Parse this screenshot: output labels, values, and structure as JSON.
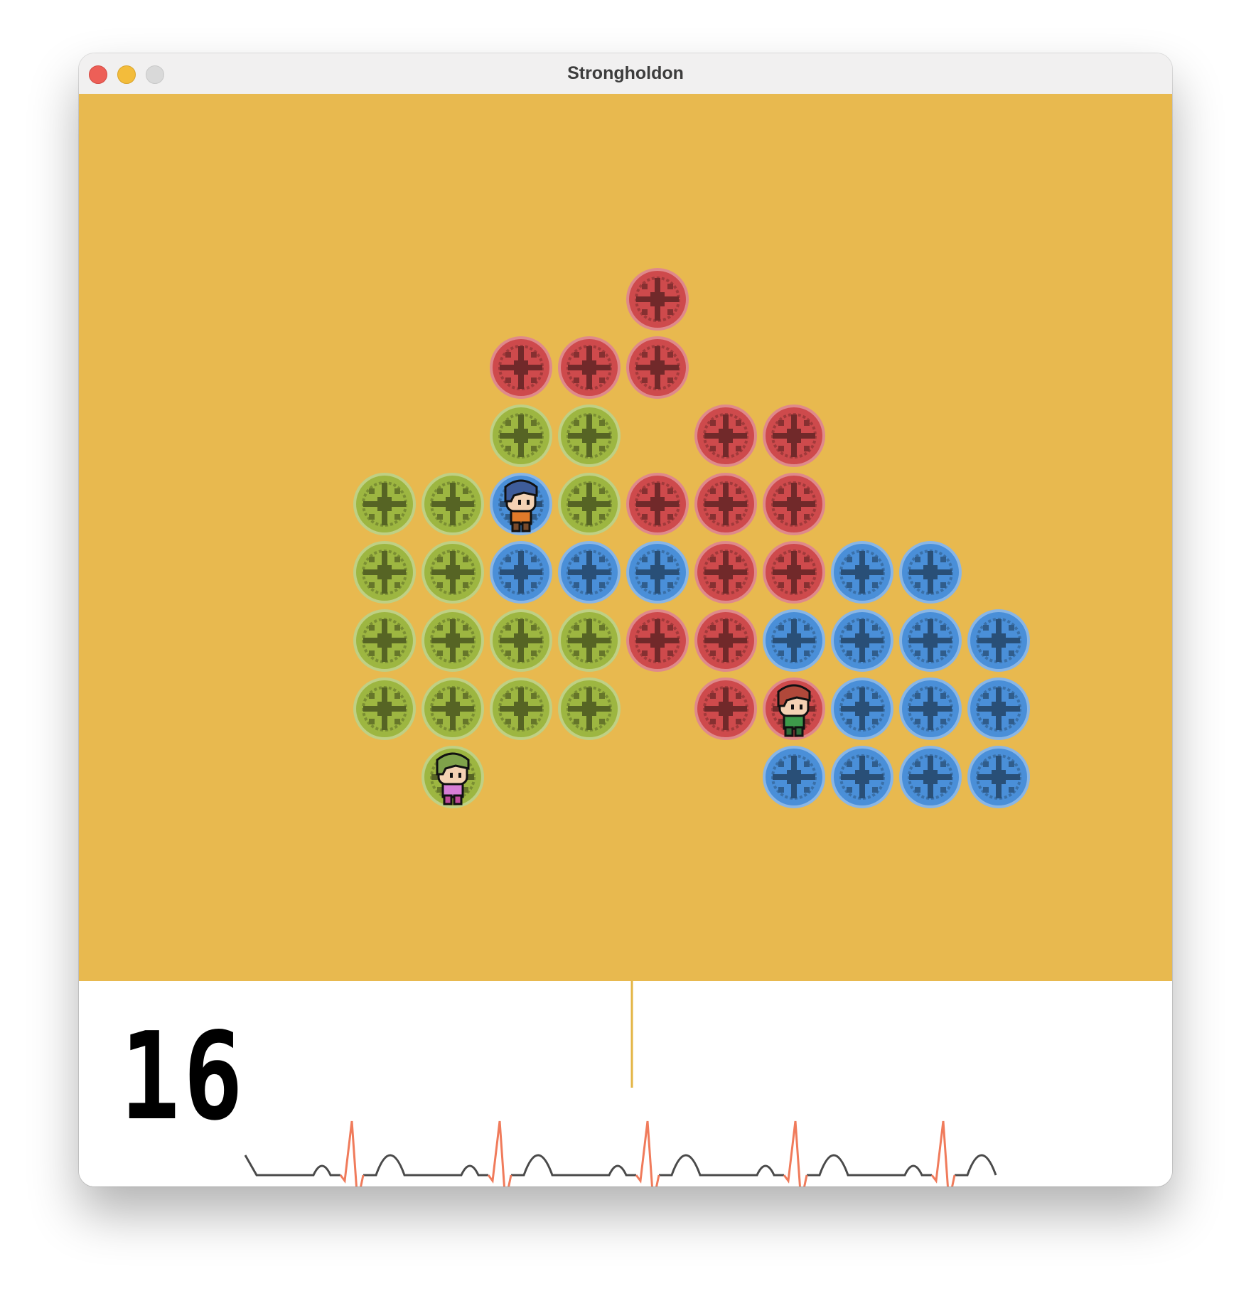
{
  "window": {
    "title": "Strongholdon"
  },
  "colors": {
    "board_background": "#E8B94F",
    "red_tile": "#CE4A4C",
    "green_tile": "#9DB641",
    "blue_tile": "#4A8FD8",
    "ecg_baseline": "#4a4a4a",
    "ecg_spike": "#F07B5B",
    "ecg_cursor": "#E3B545"
  },
  "board": {
    "columns": 12,
    "rows": 8,
    "tiles": [
      {
        "col": 4,
        "row": 0,
        "color": "red"
      },
      {
        "col": 2,
        "row": 1,
        "color": "red"
      },
      {
        "col": 3,
        "row": 1,
        "color": "red"
      },
      {
        "col": 4,
        "row": 1,
        "color": "red"
      },
      {
        "col": 2,
        "row": 2,
        "color": "green"
      },
      {
        "col": 3,
        "row": 2,
        "color": "green"
      },
      {
        "col": 5,
        "row": 2,
        "color": "red"
      },
      {
        "col": 6,
        "row": 2,
        "color": "red"
      },
      {
        "col": 0,
        "row": 3,
        "color": "green"
      },
      {
        "col": 1,
        "row": 3,
        "color": "green"
      },
      {
        "col": 2,
        "row": 3,
        "color": "blue"
      },
      {
        "col": 3,
        "row": 3,
        "color": "green"
      },
      {
        "col": 4,
        "row": 3,
        "color": "red"
      },
      {
        "col": 5,
        "row": 3,
        "color": "red"
      },
      {
        "col": 6,
        "row": 3,
        "color": "red"
      },
      {
        "col": 0,
        "row": 4,
        "color": "green"
      },
      {
        "col": 1,
        "row": 4,
        "color": "green"
      },
      {
        "col": 2,
        "row": 4,
        "color": "blue"
      },
      {
        "col": 3,
        "row": 4,
        "color": "blue"
      },
      {
        "col": 4,
        "row": 4,
        "color": "blue"
      },
      {
        "col": 5,
        "row": 4,
        "color": "red"
      },
      {
        "col": 6,
        "row": 4,
        "color": "red"
      },
      {
        "col": 7,
        "row": 4,
        "color": "blue"
      },
      {
        "col": 8,
        "row": 4,
        "color": "blue"
      },
      {
        "col": 0,
        "row": 5,
        "color": "green"
      },
      {
        "col": 1,
        "row": 5,
        "color": "green"
      },
      {
        "col": 2,
        "row": 5,
        "color": "green"
      },
      {
        "col": 3,
        "row": 5,
        "color": "green"
      },
      {
        "col": 4,
        "row": 5,
        "color": "red"
      },
      {
        "col": 5,
        "row": 5,
        "color": "red"
      },
      {
        "col": 6,
        "row": 5,
        "color": "blue"
      },
      {
        "col": 7,
        "row": 5,
        "color": "blue"
      },
      {
        "col": 8,
        "row": 5,
        "color": "blue"
      },
      {
        "col": 9,
        "row": 5,
        "color": "blue"
      },
      {
        "col": 0,
        "row": 6,
        "color": "green"
      },
      {
        "col": 1,
        "row": 6,
        "color": "green"
      },
      {
        "col": 2,
        "row": 6,
        "color": "green"
      },
      {
        "col": 3,
        "row": 6,
        "color": "green"
      },
      {
        "col": 5,
        "row": 6,
        "color": "red"
      },
      {
        "col": 6,
        "row": 6,
        "color": "red"
      },
      {
        "col": 7,
        "row": 6,
        "color": "blue"
      },
      {
        "col": 8,
        "row": 6,
        "color": "blue"
      },
      {
        "col": 9,
        "row": 6,
        "color": "blue"
      },
      {
        "col": 1,
        "row": 7,
        "color": "green"
      },
      {
        "col": 6,
        "row": 7,
        "color": "blue"
      },
      {
        "col": 7,
        "row": 7,
        "color": "blue"
      },
      {
        "col": 8,
        "row": 7,
        "color": "blue"
      },
      {
        "col": 9,
        "row": 7,
        "color": "blue"
      }
    ],
    "characters": [
      {
        "name": "blue-haired-hero",
        "col": 2,
        "row": 3,
        "hair": "#3E5C9A",
        "shirt": "#E07A2A",
        "pants": "#7A4A2A"
      },
      {
        "name": "red-haired-hero",
        "col": 6,
        "row": 6,
        "hair": "#B0483A",
        "shirt": "#3D9A4A",
        "pants": "#2E6E3A"
      },
      {
        "name": "green-haired-hero",
        "col": 1,
        "row": 7,
        "hair": "#7FA24A",
        "shirt": "#D77ED6",
        "pants": "#C04A9A"
      }
    ]
  },
  "hud": {
    "counter": "16",
    "ecg_beats": 5,
    "cursor_beat": 2
  }
}
